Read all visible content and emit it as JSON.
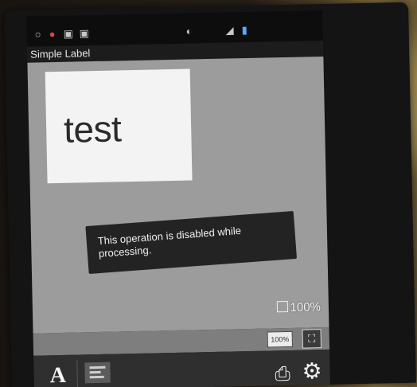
{
  "app": {
    "title": "Simple Label"
  },
  "canvas": {
    "label_text": "test",
    "zoom_text": "100%"
  },
  "toast": {
    "message": "This operation is disabled while processing."
  },
  "fit_bar": {
    "zoom_100_label": "100%",
    "fit_icon": "expand-icon"
  },
  "toolbar": {
    "font_icon": "A",
    "align_icon": "text-align-icon",
    "preview_icon": "print-preview-icon",
    "settings_icon": "gear-icon"
  },
  "colors": {
    "canvas_bg": "#9c9c9c",
    "label_bg": "#f3f3f3",
    "toast_bg": "#232323",
    "toolbar_bg": "#2f2f2f"
  }
}
